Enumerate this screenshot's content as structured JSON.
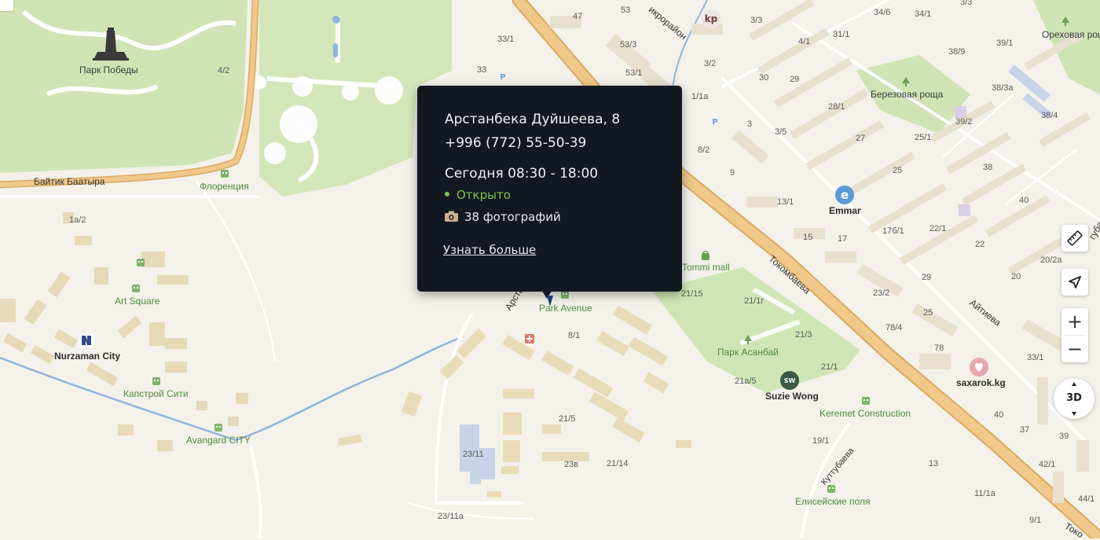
{
  "popup": {
    "address": "Арстанбека Дуйшеева, 8",
    "phone": "+996 (772) 55-50-39",
    "hours": "Сегодня 08:30 - 18:00",
    "status": "Открыто",
    "photos": "38 фотографий",
    "more_link": "Узнать больше",
    "status_color": "#7dc44b"
  },
  "controls": {
    "ruler_icon": "ruler-icon",
    "locate_icon": "navigation-arrow-icon",
    "zoom_in": "+",
    "zoom_out": "−",
    "view_3d": "3D"
  },
  "places": {
    "park_pobedy": "Парк Победы",
    "berezovaya": "Березовая роща",
    "orekhovaya": "Ореховая роща",
    "florentsiya": "Флоренция",
    "art_square": "Art Square",
    "nurzaman": "Nurzaman City",
    "kapstroy": "Капстрой Сити",
    "avangard": "Avangard CITY",
    "park_avenue": "Park Avenue",
    "tommi": "Tommi mall",
    "emmar": "Emmar",
    "park_asanbay": "Парк Асанбай",
    "suzie": "Suzie Wong",
    "keremet": "Keremet Construction",
    "saxarok": "saxarok.kg",
    "eliseyskie": "Елисейские поля"
  },
  "streets": {
    "baytik": "Байтик Баатыра",
    "arstanbeka": "Арстанбека",
    "tokombaeva": "Токомбаева",
    "aytieva": "Айтиева",
    "kuttubaeva": "Куттубаева",
    "mikrorayon": "икрорайон",
    "toko2": "Токо",
    "tub": "губа"
  },
  "house_numbers": {
    "n47": "47",
    "n53": "53",
    "n33_1": "33/1",
    "n53_3": "53/3",
    "n33": "33",
    "n53_1": "53/1",
    "n3_3": "3/3",
    "n4_1": "4/1",
    "n31_1": "31/1",
    "n3_2": "3/2",
    "n30": "30",
    "n29": "29",
    "n1_1a": "1/1а",
    "n3": "3",
    "n3_5": "3/5",
    "n8_2": "8/2",
    "n9": "9",
    "n13_1": "13/1",
    "n15": "15",
    "n17": "17",
    "n27": "27",
    "n25": "25",
    "n25_1": "25/1",
    "n28_1": "28/1",
    "n34_6": "34/6",
    "n34_1": "34/1",
    "n38_9": "38/9",
    "n39_1": "39/1",
    "n38_3a": "38/3а",
    "n39_2": "39/2",
    "n38_4": "38/4",
    "n38": "38",
    "n40": "40",
    "n22": "22",
    "n22_1": "22/1",
    "n17b_1": "17б/1",
    "n20_2a": "20/2а",
    "n29b": "29",
    "n20": "20",
    "n23_2": "23/2",
    "n78_4": "78/4",
    "n78": "78",
    "n25b": "25",
    "n21_3": "21/3",
    "n21_1": "21/1",
    "n21a_5": "21а/5",
    "n21_15": "21/15",
    "n21_1g": "21/1г",
    "n33_1b": "33/1",
    "n40b": "40",
    "n37": "37",
    "n39": "39",
    "n42_1": "42/1",
    "n44_1": "44/1",
    "n9_1": "9/1",
    "n11_1a": "11/1а",
    "n13": "13",
    "n19_1": "19/1",
    "n8_1": "8/1",
    "n21_5": "21/5",
    "n23_11": "23/11",
    "n23v": "23в",
    "n21_14": "21/14",
    "n23_11a": "23/11а",
    "n1a_2": "1а/2",
    "n4_2": "4/2",
    "n3_3top": "3/3"
  },
  "colors": {
    "park": "#cfe3b4",
    "road_major": "#f0c88a",
    "road_major_edge": "#d9aa5f",
    "building": "#e8e0ce",
    "building_tan": "#e6d9b8",
    "popup_bg": "#141821"
  }
}
